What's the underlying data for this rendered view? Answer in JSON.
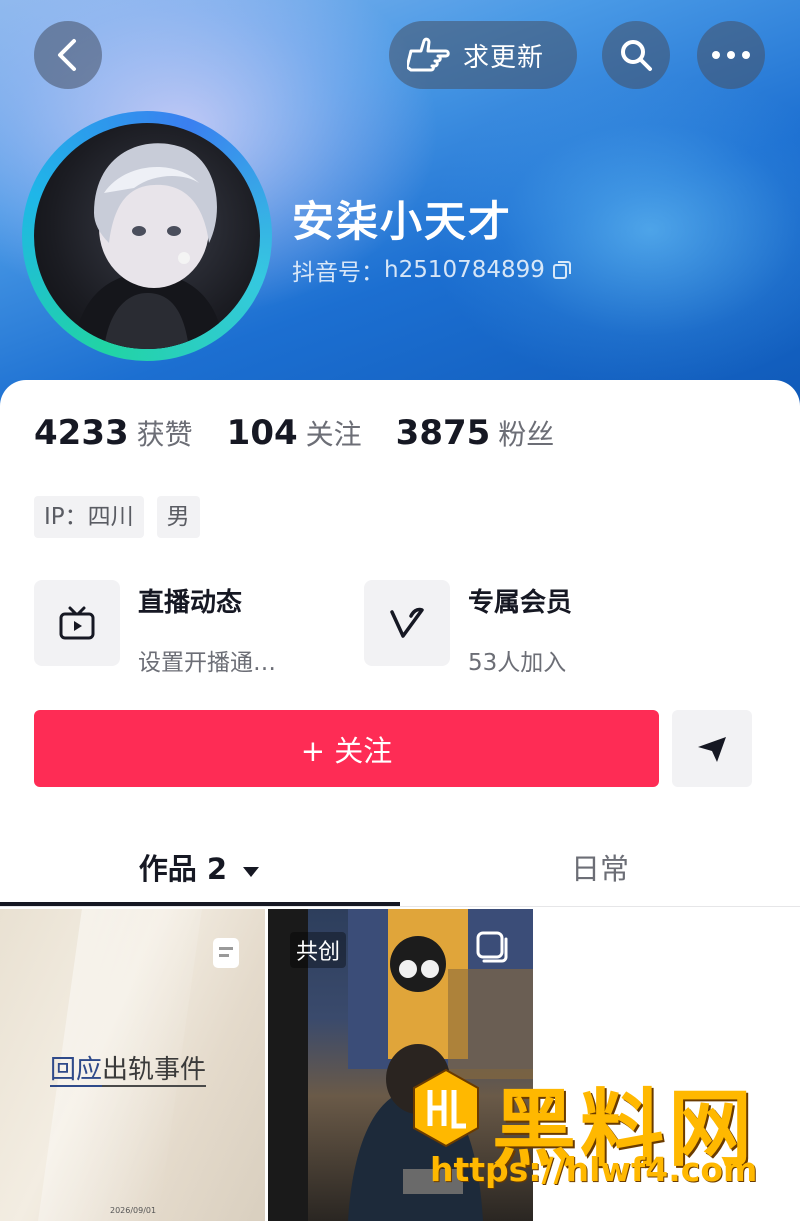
{
  "header": {
    "update_request_label": "求更新"
  },
  "profile": {
    "nickname": "安柒小天才",
    "douyin_id_label": "抖音号：",
    "douyin_id": "h2510784899"
  },
  "stats": [
    {
      "value": "4233",
      "label": "获赞"
    },
    {
      "value": "104",
      "label": "关注"
    },
    {
      "value": "3875",
      "label": "粉丝"
    }
  ],
  "tags": [
    {
      "text": "IP：四川"
    },
    {
      "text": "男"
    }
  ],
  "features": [
    {
      "title": "直播动态",
      "subtitle": "设置开播通…",
      "icon": "tv-icon"
    },
    {
      "title": "专属会员",
      "subtitle": "53人加入",
      "icon": "v-membership-icon"
    }
  ],
  "actions": {
    "follow_label": "+ 关注"
  },
  "tabs": {
    "works_label": "作品 2",
    "daily_label": "日常"
  },
  "works": [
    {
      "title_link": "回应",
      "title_rest": "出轨事件",
      "date": "2026/09/01"
    },
    {
      "badge": "共创"
    }
  ],
  "watermark": {
    "text": "黑料网",
    "url": "https://hlwf4.com"
  },
  "colors": {
    "accent": "#fe2c55",
    "watermark": "#ffb800"
  }
}
